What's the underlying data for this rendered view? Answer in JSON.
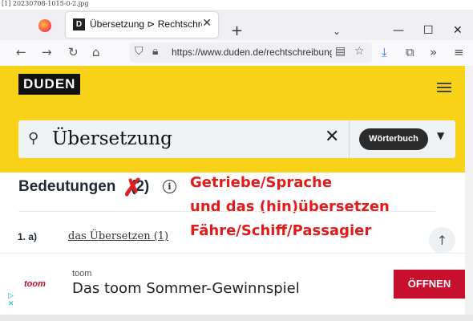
{
  "caption": "[1] 20230708-1015-0-2.jpg",
  "browser": {
    "tab_title": "Übersetzung ⊳ Rechtschreibung",
    "tab_favicon": "D",
    "url": "https://www.duden.de/rechtschreibung/Uebersetzung",
    "win_minimize": "—",
    "win_maximize": "☐",
    "win_close": "✕"
  },
  "site": {
    "logo": "DUDEN",
    "search_value": "Übersetzung",
    "dictionary_button": "Wörterbuch",
    "accent_color": "#f7d216"
  },
  "content": {
    "heading": "Bedeutungen",
    "heading_count": "(2)",
    "sense_number": "1.  a)",
    "sense_text": "das Übersetzen (1)"
  },
  "annotation": {
    "lines": [
      "Getriebe/Sprache",
      "und das (hin)übersetzen",
      "Fähre/Schiff/Passagier"
    ],
    "color": "#e31a1a"
  },
  "ad": {
    "brand": "toom",
    "logo": "toom",
    "title": "Das toom Sommer-Gewinnspiel",
    "button": "ÖFFNEN"
  }
}
